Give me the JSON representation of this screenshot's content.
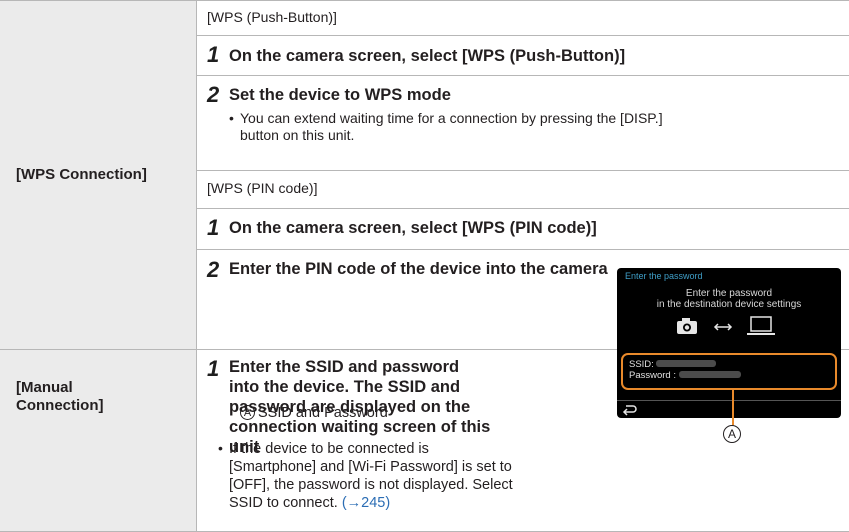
{
  "wps": {
    "label": "[WPS Connection]",
    "push_button": {
      "heading": "[WPS (Push-Button)]",
      "steps": [
        {
          "num": "1",
          "text": "On the camera screen, select [WPS (Push-Button)]"
        },
        {
          "num": "2",
          "text": "Set the device to WPS mode"
        }
      ],
      "bullet_line1": "You can extend waiting time for a connection by pressing the [DISP.]",
      "bullet_line2": "button on this unit."
    },
    "pin_code": {
      "heading": "[WPS (PIN code)]",
      "steps": [
        {
          "num": "1",
          "text": "On the camera screen, select [WPS (PIN code)]"
        },
        {
          "num": "2",
          "text": "Enter the PIN code of the device into the camera"
        }
      ]
    }
  },
  "manual": {
    "label_line1": "[Manual",
    "label_line2": "Connection]",
    "step": {
      "num": "1",
      "lines": [
        "Enter the SSID and password",
        "into the device. The SSID and",
        "password are displayed on the",
        "connection waiting screen of this",
        "unit"
      ]
    },
    "annotation_symbol": "A",
    "annotation_text": "SSID and Password",
    "bullet_lines": [
      "If the device to be connected is",
      "[Smartphone] and [Wi-Fi Password] is set to",
      "[OFF], the password is not displayed. Select",
      "SSID to connect."
    ],
    "page_ref": "(→245)"
  },
  "screen": {
    "title": "Enter the password",
    "message_line1": "Enter the password",
    "message_line2": "in the destination device settings",
    "ssid_label": "SSID:",
    "password_label": "Password :",
    "callout_symbol": "A",
    "colors": {
      "title": "#3f9ec7",
      "highlight": "#e98a2b"
    }
  }
}
